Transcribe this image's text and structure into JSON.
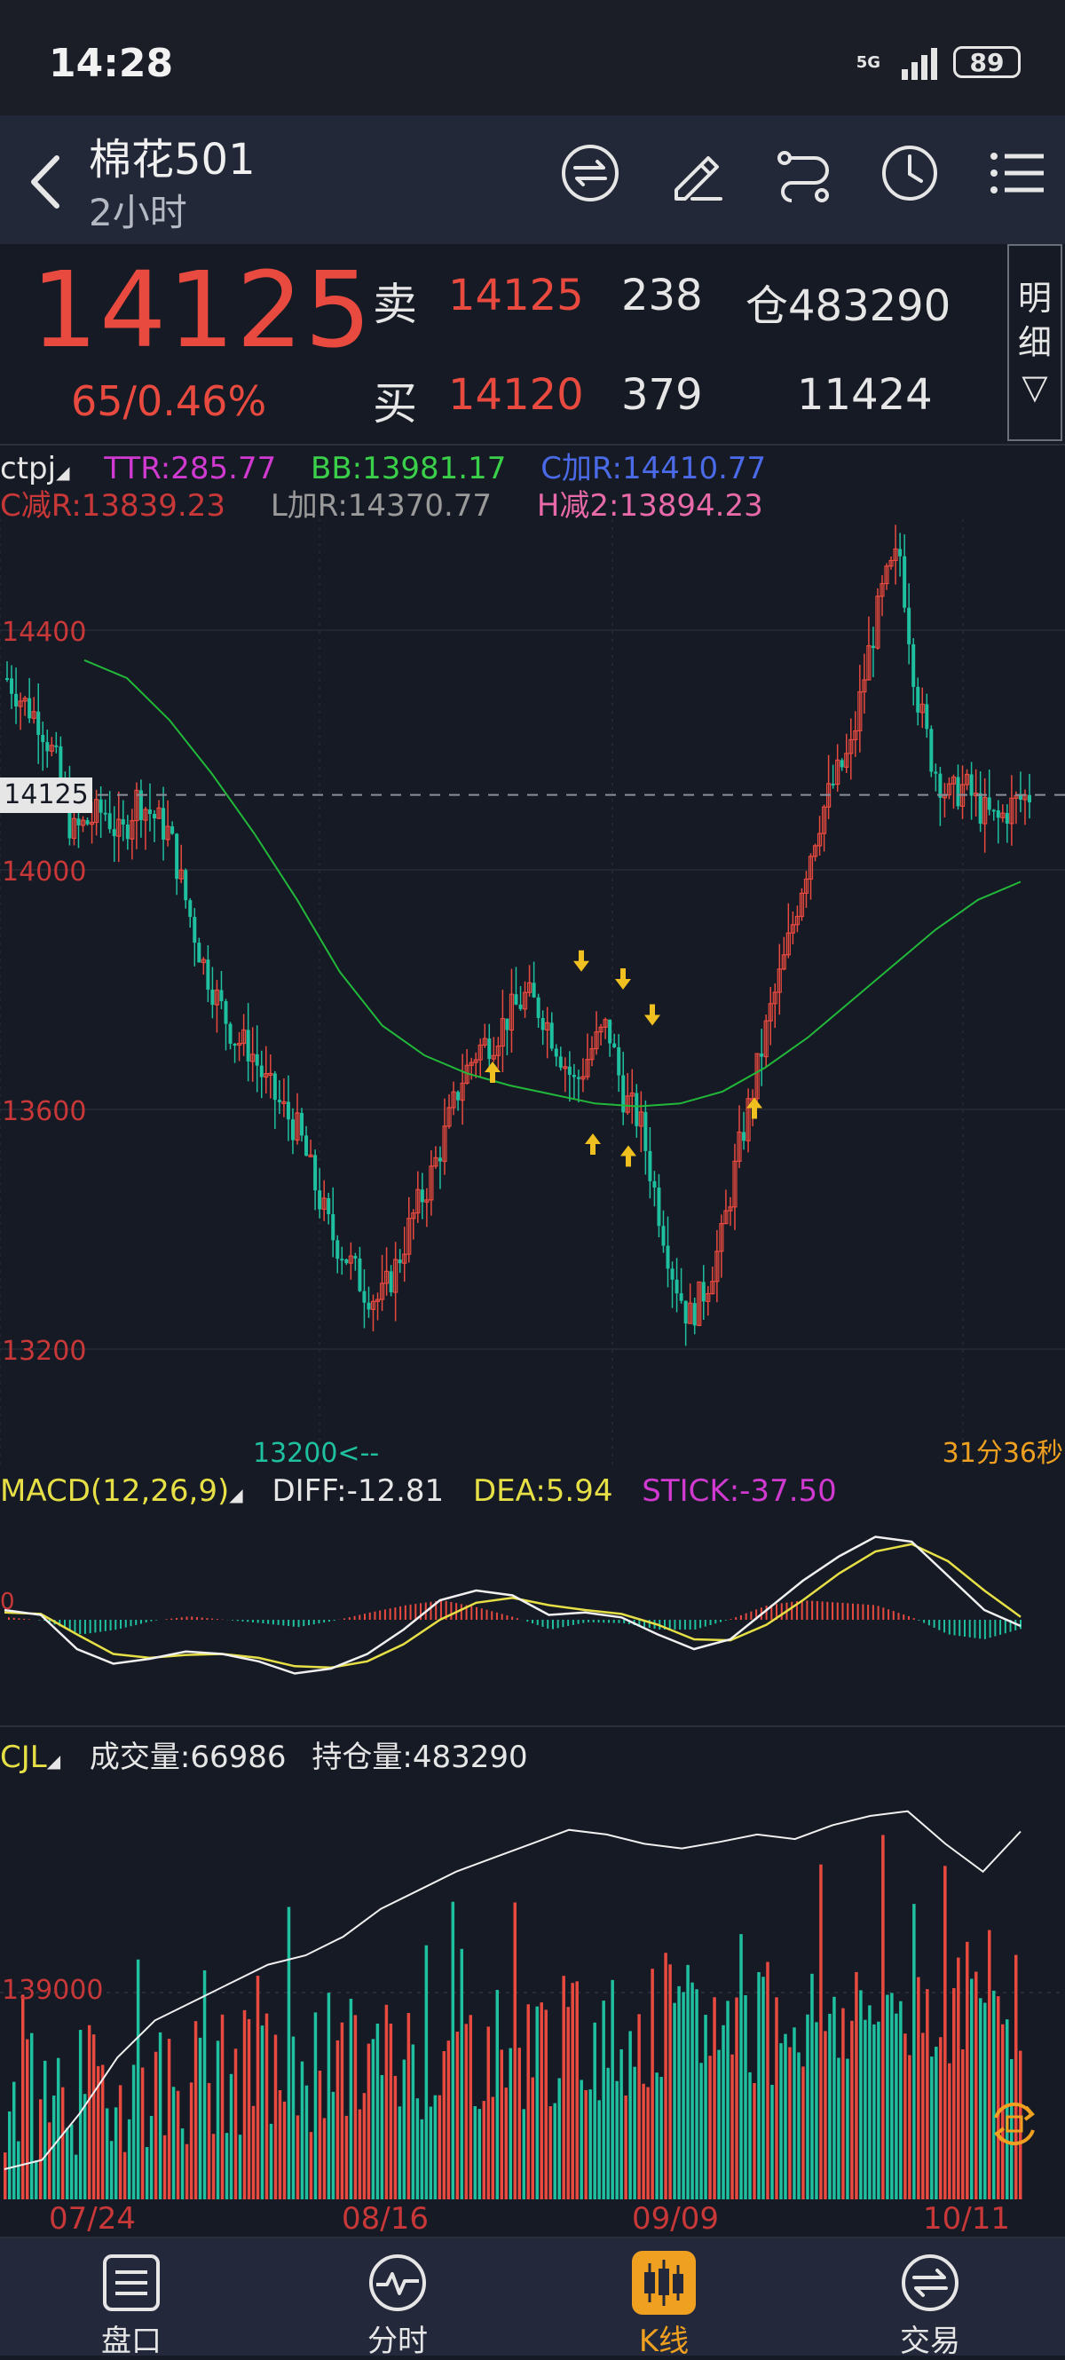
{
  "status": {
    "time": "14:28",
    "network": "5G",
    "battery": "89"
  },
  "header": {
    "title": "棉花501",
    "subtitle": "2小时"
  },
  "quote": {
    "last": "14125",
    "change": "65/0.46%",
    "sell_label": "卖",
    "sell_price": "14125",
    "sell_vol": "238",
    "buy_label": "买",
    "buy_price": "14120",
    "buy_vol": "379",
    "oi_label": "仓483290",
    "volume": "11424",
    "detail": [
      "明",
      "细",
      "▽"
    ]
  },
  "indicators": {
    "line1": [
      {
        "text": "ctpj",
        "color": "#e6e6e6"
      },
      {
        "text": "TTR:285.77",
        "color": "#d03ad0"
      },
      {
        "text": "BB:13981.17",
        "color": "#3ad04a"
      },
      {
        "text": "C加R:14410.77",
        "color": "#4a6ae8"
      }
    ],
    "line2": [
      {
        "text": "C减R:13839.23",
        "color": "#c83838"
      },
      {
        "text": "L加R:14370.77",
        "color": "#9a9a9a"
      },
      {
        "text": "H减2:13894.23",
        "color": "#e86aa8"
      }
    ]
  },
  "main_chart": {
    "price_labels": [
      "14400",
      "14000",
      "13600",
      "13200"
    ],
    "current_label": "14125",
    "low_label": "13200<--",
    "countdown": "31分36秒"
  },
  "macd": {
    "title": "MACD(12,26,9)",
    "diff": "DIFF:-12.81",
    "dea": "DEA:5.94",
    "stick": "STICK:-37.50",
    "zero_label": "0"
  },
  "volume": {
    "title": "CJL",
    "vol": "成交量:66986",
    "oi": "持仓量:483290",
    "scale_label": "139000"
  },
  "date_axis": [
    "07/24",
    "08/16",
    "09/09",
    "10/11"
  ],
  "chart_data": [
    {
      "type": "candlestick",
      "title": "棉花501 2小时",
      "ylim": [
        13200,
        14500
      ],
      "x_ticks": [
        "07/24",
        "08/16",
        "09/09",
        "10/11"
      ],
      "close_path": [
        14320,
        14280,
        14250,
        14180,
        14060,
        14080,
        14100,
        14050,
        14120,
        14090,
        14060,
        13950,
        13850,
        13780,
        13720,
        13700,
        13640,
        13600,
        13560,
        13470,
        13390,
        13350,
        13300,
        13280,
        13340,
        13420,
        13480,
        13560,
        13650,
        13700,
        13720,
        13760,
        13790,
        13760,
        13700,
        13640,
        13700,
        13740,
        13620,
        13580,
        13450,
        13330,
        13250,
        13300,
        13380,
        13520,
        13640,
        13760,
        13860,
        13980,
        14080,
        14150,
        14200,
        14350,
        14470,
        14530,
        14300,
        14180,
        14120,
        14140,
        14100,
        14080,
        14110,
        14125
      ],
      "ma_path": [
        14350,
        14320,
        14250,
        14160,
        14060,
        13950,
        13830,
        13740,
        13690,
        13660,
        13640,
        13625,
        13610,
        13605,
        13610,
        13630,
        13670,
        13720,
        13780,
        13840,
        13900,
        13950,
        13980
      ],
      "current": 14125,
      "low": 13200
    },
    {
      "type": "line",
      "title": "MACD(12,26,9)",
      "series": [
        {
          "name": "DIFF",
          "values": [
            20,
            10,
            -60,
            -90,
            -80,
            -65,
            -70,
            -85,
            -110,
            -100,
            -70,
            -20,
            40,
            60,
            50,
            10,
            15,
            5,
            -30,
            -60,
            -40,
            20,
            80,
            130,
            170,
            160,
            90,
            20,
            -12.81
          ]
        },
        {
          "name": "DEA",
          "values": [
            15,
            12,
            -30,
            -70,
            -78,
            -72,
            -70,
            -78,
            -95,
            -98,
            -85,
            -50,
            0,
            35,
            45,
            30,
            20,
            12,
            -10,
            -40,
            -42,
            -10,
            40,
            95,
            140,
            155,
            120,
            60,
            5.94
          ]
        }
      ],
      "stick_last": -37.5
    },
    {
      "type": "bar",
      "title": "CJL",
      "vol_last": 66986,
      "oi_last": 483290,
      "oi_path": [
        120000,
        130000,
        180000,
        240000,
        280000,
        300000,
        320000,
        340000,
        350000,
        370000,
        400000,
        420000,
        440000,
        455000,
        470000,
        485000,
        480000,
        470000,
        465000,
        472000,
        480000,
        475000,
        490000,
        500000,
        505000,
        470000,
        440000,
        483290
      ]
    }
  ],
  "tabs": [
    {
      "label": "盘口"
    },
    {
      "label": "分时"
    },
    {
      "label": "K线"
    },
    {
      "label": "交易"
    }
  ],
  "colors": {
    "up": "#e94a3f",
    "down": "#1fc0a0",
    "bg": "#161a24",
    "accent": "#f0a020"
  }
}
